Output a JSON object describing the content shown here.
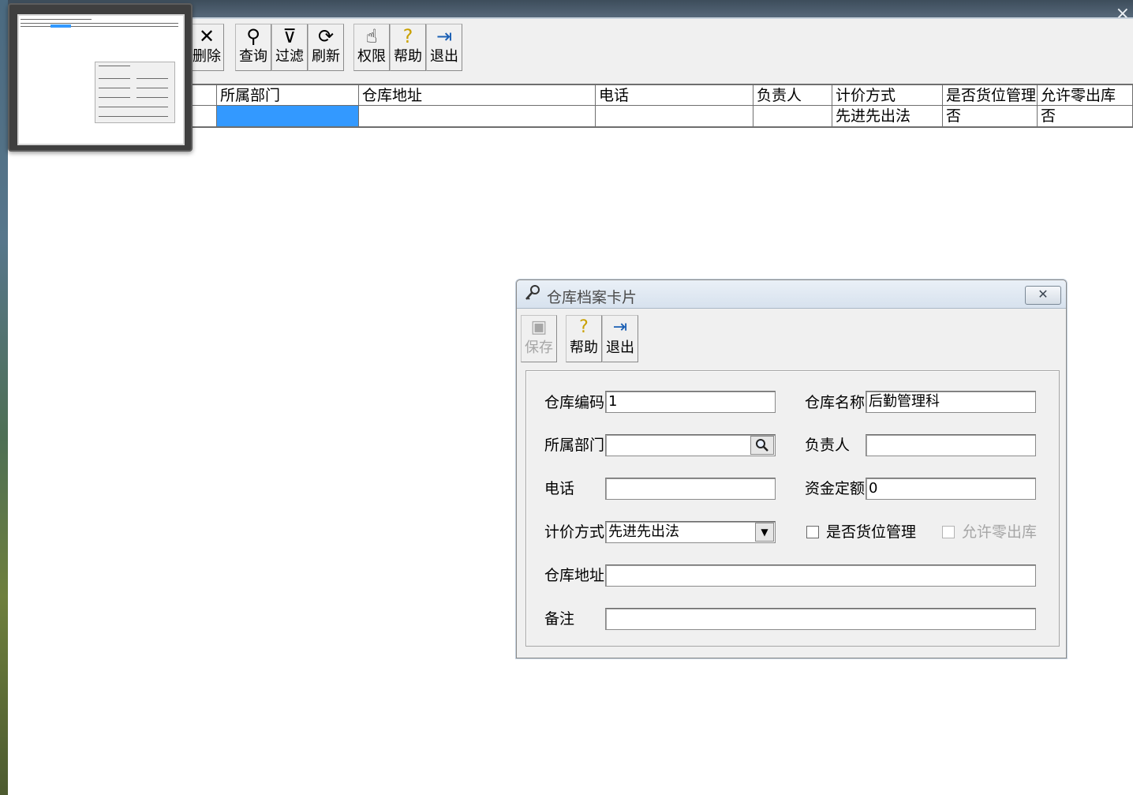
{
  "top_bar": {
    "close_glyph": "×"
  },
  "toolbar": {
    "buttons": [
      {
        "label": "删除",
        "icon": "delete-x-icon",
        "glyph": "✕"
      },
      {
        "label": "查询",
        "icon": "binoculars-icon",
        "glyph": "⚲"
      },
      {
        "label": "过滤",
        "icon": "filter-icon",
        "glyph": "⊽"
      },
      {
        "label": "刷新",
        "icon": "refresh-icon",
        "glyph": "⟳"
      },
      {
        "label": "权限",
        "icon": "permission-hand-icon",
        "glyph": "☝"
      },
      {
        "label": "帮助",
        "icon": "help-question-icon",
        "glyph": "?"
      },
      {
        "label": "退出",
        "icon": "exit-door-icon",
        "glyph": "⇥"
      }
    ]
  },
  "grid": {
    "columns": [
      "所属部门",
      "仓库地址",
      "电话",
      "负责人",
      "计价方式",
      "是否货位管理",
      "允许零出库"
    ],
    "rows": [
      [
        "",
        "",
        "",
        "",
        "先进先出法",
        "否",
        "否"
      ]
    ],
    "selected_color": "#3399ff"
  },
  "dialog": {
    "title": "仓库档案卡片",
    "title_icon": "key-icon",
    "close_glyph": "✕",
    "toolbar": [
      {
        "label": "保存",
        "icon": "save-disk-icon",
        "glyph": "▣",
        "enabled": false
      },
      {
        "label": "帮助",
        "icon": "help-question-icon",
        "glyph": "?",
        "enabled": true
      },
      {
        "label": "退出",
        "icon": "exit-door-icon",
        "glyph": "⇥",
        "enabled": true
      }
    ],
    "fields": {
      "code_label": "仓库编码",
      "code_value": "1",
      "name_label": "仓库名称",
      "name_value": "后勤管理科",
      "dept_label": "所属部门",
      "dept_value": "",
      "manager_label": "负责人",
      "manager_value": "",
      "phone_label": "电话",
      "phone_value": "",
      "fund_label": "资金定额",
      "fund_value": "0",
      "pricing_label": "计价方式",
      "pricing_value": "先进先出法",
      "location_mgmt_label": "是否货位管理",
      "location_mgmt_checked": false,
      "allow_zero_label": "允许零出库",
      "allow_zero_checked": false,
      "allow_zero_enabled": false,
      "address_label": "仓库地址",
      "address_value": "",
      "remark_label": "备注",
      "remark_value": ""
    }
  }
}
